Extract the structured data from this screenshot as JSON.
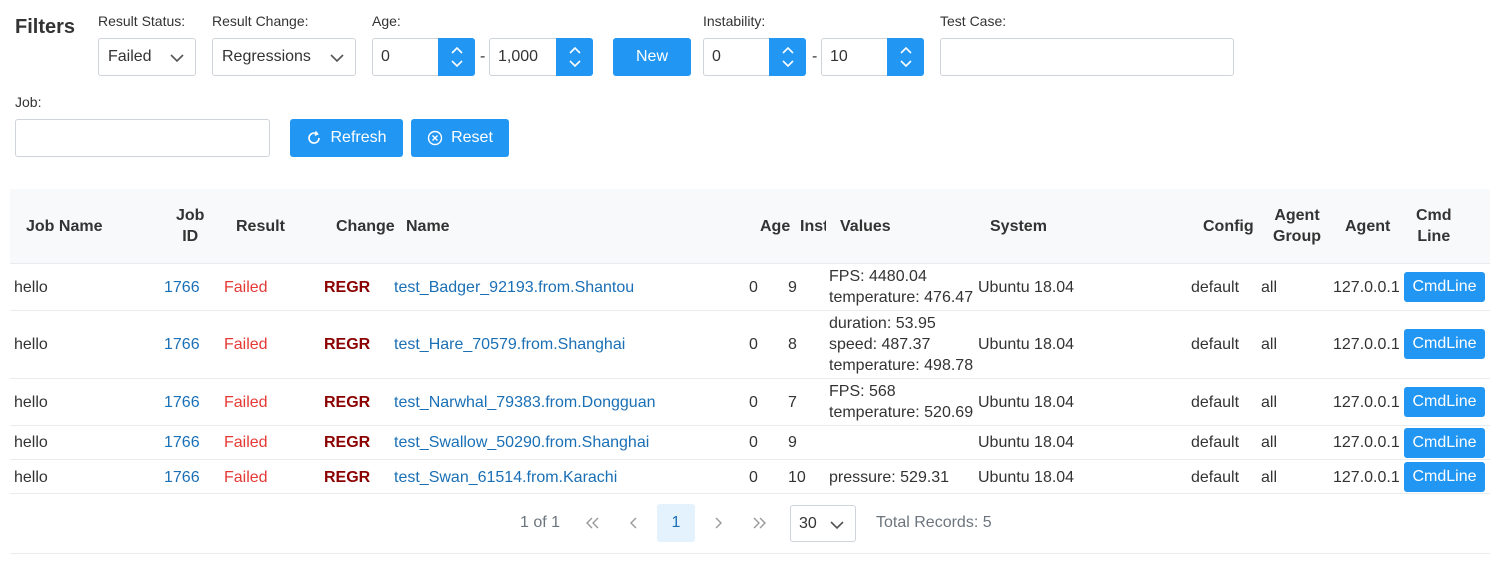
{
  "filters": {
    "title": "Filters",
    "result_status": {
      "label": "Result Status:",
      "value": "Failed"
    },
    "result_change": {
      "label": "Result Change:",
      "value": "Regressions"
    },
    "age": {
      "label": "Age:",
      "min": "0",
      "max": "1,000",
      "sep": "-"
    },
    "new_button": "New",
    "instability": {
      "label": "Instability:",
      "min": "0",
      "max": "10",
      "sep": "-"
    },
    "test_case": {
      "label": "Test Case:",
      "value": ""
    },
    "job": {
      "label": "Job:",
      "value": ""
    },
    "refresh_button": "Refresh",
    "reset_button": "Reset"
  },
  "table": {
    "headers": {
      "job_name": "Job Name",
      "job_id_1": "Job",
      "job_id_2": "ID",
      "result": "Result",
      "change": "Change",
      "name": "Name",
      "age": "Age",
      "inst": "Inst",
      "values": "Values",
      "system": "System",
      "config": "Config",
      "agent_group_1": "Agent",
      "agent_group_2": "Group",
      "agent": "Agent",
      "cmd_line_1": "Cmd",
      "cmd_line_2": "Line"
    },
    "rows": [
      {
        "job_name": "hello",
        "job_id": "1766",
        "result": "Failed",
        "change": "REGR",
        "name": "test_Badger_92193.from.Shantou",
        "age": "0",
        "inst": "9",
        "values": [
          "FPS: 4480.04",
          "temperature: 476.47"
        ],
        "system": "Ubuntu 18.04",
        "config": "default",
        "agent_group": "all",
        "agent": "127.0.0.1",
        "cmd": "CmdLine"
      },
      {
        "job_name": "hello",
        "job_id": "1766",
        "result": "Failed",
        "change": "REGR",
        "name": "test_Hare_70579.from.Shanghai",
        "age": "0",
        "inst": "8",
        "values": [
          "duration: 53.95",
          "speed: 487.37",
          "temperature: 498.78"
        ],
        "system": "Ubuntu 18.04",
        "config": "default",
        "agent_group": "all",
        "agent": "127.0.0.1",
        "cmd": "CmdLine"
      },
      {
        "job_name": "hello",
        "job_id": "1766",
        "result": "Failed",
        "change": "REGR",
        "name": "test_Narwhal_79383.from.Dongguan",
        "age": "0",
        "inst": "7",
        "values": [
          "FPS: 568",
          "temperature: 520.69"
        ],
        "system": "Ubuntu 18.04",
        "config": "default",
        "agent_group": "all",
        "agent": "127.0.0.1",
        "cmd": "CmdLine"
      },
      {
        "job_name": "hello",
        "job_id": "1766",
        "result": "Failed",
        "change": "REGR",
        "name": "test_Swallow_50290.from.Shanghai",
        "age": "0",
        "inst": "9",
        "values": [],
        "system": "Ubuntu 18.04",
        "config": "default",
        "agent_group": "all",
        "agent": "127.0.0.1",
        "cmd": "CmdLine"
      },
      {
        "job_name": "hello",
        "job_id": "1766",
        "result": "Failed",
        "change": "REGR",
        "name": "test_Swan_61514.from.Karachi",
        "age": "0",
        "inst": "10",
        "values": [
          "pressure: 529.31"
        ],
        "system": "Ubuntu 18.04",
        "config": "default",
        "agent_group": "all",
        "agent": "127.0.0.1",
        "cmd": "CmdLine"
      }
    ]
  },
  "pagination": {
    "page_info": "1 of 1",
    "current_page": "1",
    "rows_per_page": "30",
    "total_records": "Total Records: 5"
  }
}
